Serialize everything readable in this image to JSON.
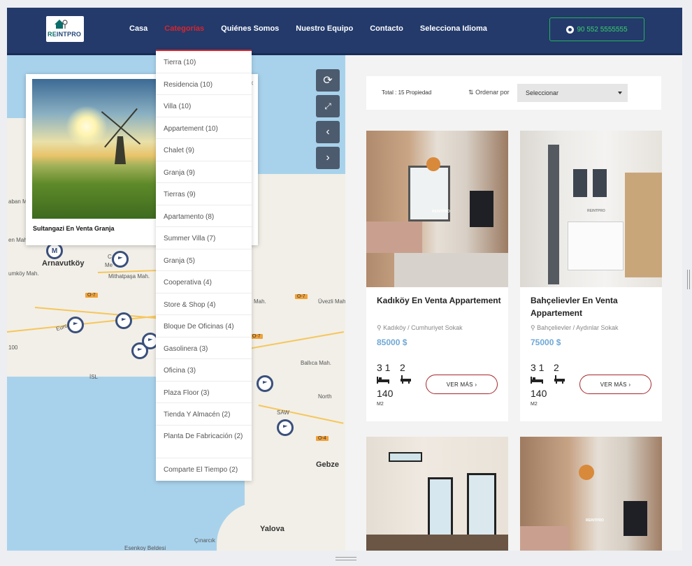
{
  "header": {
    "logo_text_a": "RE",
    "logo_text_b": "INTPRO",
    "nav": [
      {
        "label": "Casa",
        "active": false
      },
      {
        "label": "Categorías",
        "active": true
      },
      {
        "label": "Quiénes Somos",
        "active": false
      },
      {
        "label": "Nuestro Equipo",
        "active": false
      },
      {
        "label": "Contacto",
        "active": false
      },
      {
        "label": "Selecciona Idioma",
        "active": false
      }
    ],
    "phone": "90 552 5555555"
  },
  "colors": {
    "header_bg": "#233a6b",
    "accent_red": "#d9242d",
    "price_blue": "#6fa8d6",
    "whatsapp_green": "#26b358"
  },
  "categories": [
    "Tierra (10)",
    "Residencia (10)",
    "Villa (10)",
    "Appartement (10)",
    "Chalet (9)",
    "Granja (9)",
    "Tierras (9)",
    "Apartamento (8)",
    "Summer Villa (7)",
    "Granja (5)",
    "Cooperativa (4)",
    "Store & Shop (4)",
    "Bloque De Oficinas (4)",
    "Gasolinera (3)",
    "Oficina (3)",
    "Plaza Floor (3)",
    "Tienda Y Almacén (2)",
    "Planta De Fabricación (2)",
    "Comparte El Tiempo (2)"
  ],
  "map": {
    "popup_title": "Sultangazi En Venta Granja",
    "popup_close": "×",
    "controls": [
      "refresh-icon",
      "fullscreen-icon",
      "chevron-left-icon",
      "chevron-right-icon"
    ],
    "labels": {
      "arnavutkoy": "Arnavutköy",
      "mithatpasa": "Mithatpaşa Mah.",
      "umkoy": "umköy Mah.",
      "abanm": "aban M",
      "enm": "en Mah",
      "isl": "İSL",
      "gebze": "Gebze",
      "yalova": "Yalova",
      "cinarcik": "Çınarcık",
      "esenkoy": "Esenkoy Beldesi",
      "ballica": "Ballıca Mah.",
      "uvezli": "Üvezli Mah.",
      "saw": "SAW",
      "north": "North",
      "mah": "Mah.",
      "me": "Me",
      "c": "C",
      "n100": "100",
      "eur": "Eurc",
      "m": "M"
    },
    "road_signs": [
      "O-7",
      "O-7",
      "O-7",
      "O-4"
    ]
  },
  "listing": {
    "total": "Total : 15 Propiedad",
    "sort_label": "Ordenar por",
    "sort_value": "Seleccionar",
    "cards": [
      {
        "title": "Kadıköy En Venta Appartement",
        "address": "Kadıköy / Cumhuriyet Sokak",
        "price": "85000 $",
        "beds": "3 1",
        "baths": "2",
        "area": "140",
        "unit": "M2",
        "button": "VER MÁS ›",
        "watermark": "REINTPRO"
      },
      {
        "title": "Bahçelievler En Venta Appartement",
        "address": "Bahçelievler / Aydınlar Sokak",
        "price": "75000 $",
        "beds": "3 1",
        "baths": "2",
        "area": "140",
        "unit": "M2",
        "button": "VER MÁS ›",
        "watermark": "REINTPRO"
      }
    ],
    "watermark": "REINTPRO"
  }
}
